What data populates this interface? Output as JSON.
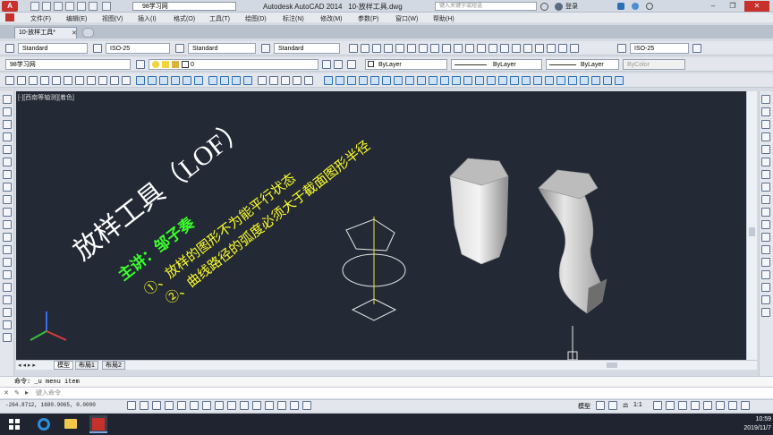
{
  "title_bar": {
    "app_button": "A",
    "workspace": "98学习网",
    "app_title": "Autodesk AutoCAD 2014",
    "file_title": "10-放样工具.dwg",
    "search_placeholder": "键入关键字或短语",
    "login_label": "登录",
    "min_icon": "minimize-icon",
    "max_icon": "restore-icon",
    "close_icon": "close-icon"
  },
  "menu": [
    "文件(F)",
    "编辑(E)",
    "视图(V)",
    "插入(I)",
    "格式(O)",
    "工具(T)",
    "绘图(D)",
    "标注(N)",
    "修改(M)",
    "参数(P)",
    "窗口(W)",
    "帮助(H)"
  ],
  "doc_tab": "10-放样工具*",
  "toolbar1": {
    "text_style": "Standard",
    "dim_style": "ISO-25",
    "table_style": "Standard",
    "mleader_style": "Standard",
    "dim_style_right": "ISO-25"
  },
  "toolbar2": {
    "workspace": "98学习网",
    "layer": "0",
    "color": "ByLayer",
    "linetype": "ByLayer",
    "lineweight": "ByLayer",
    "plotstyle": "ByColor"
  },
  "viewport_label": "[-][西南等轴测][着色]",
  "drawing_text": {
    "title": "放样工具（LOF）",
    "presenter": "主讲：邹子奏",
    "note1": "①、放样的图形不为能平行状态",
    "note2": "②、曲线路径的弧度必须大于截面图形半径"
  },
  "layout_tabs": [
    "模型",
    "布局1",
    "布局2"
  ],
  "command_history": "命令: _u menu item",
  "command_placeholder": "键入命令",
  "coordinates": "-264.8712, 1680.9065, 0.0000",
  "status": {
    "model": "模型",
    "scale": "1:1"
  },
  "clock": {
    "time": "10:59",
    "date": "2019/11/7"
  },
  "colors": {
    "canvas": "#232a35",
    "title_text": "#ffffff",
    "presenter_text": "#3cff2a",
    "note_text": "#ffff28",
    "accent_red": "#c8302c"
  }
}
